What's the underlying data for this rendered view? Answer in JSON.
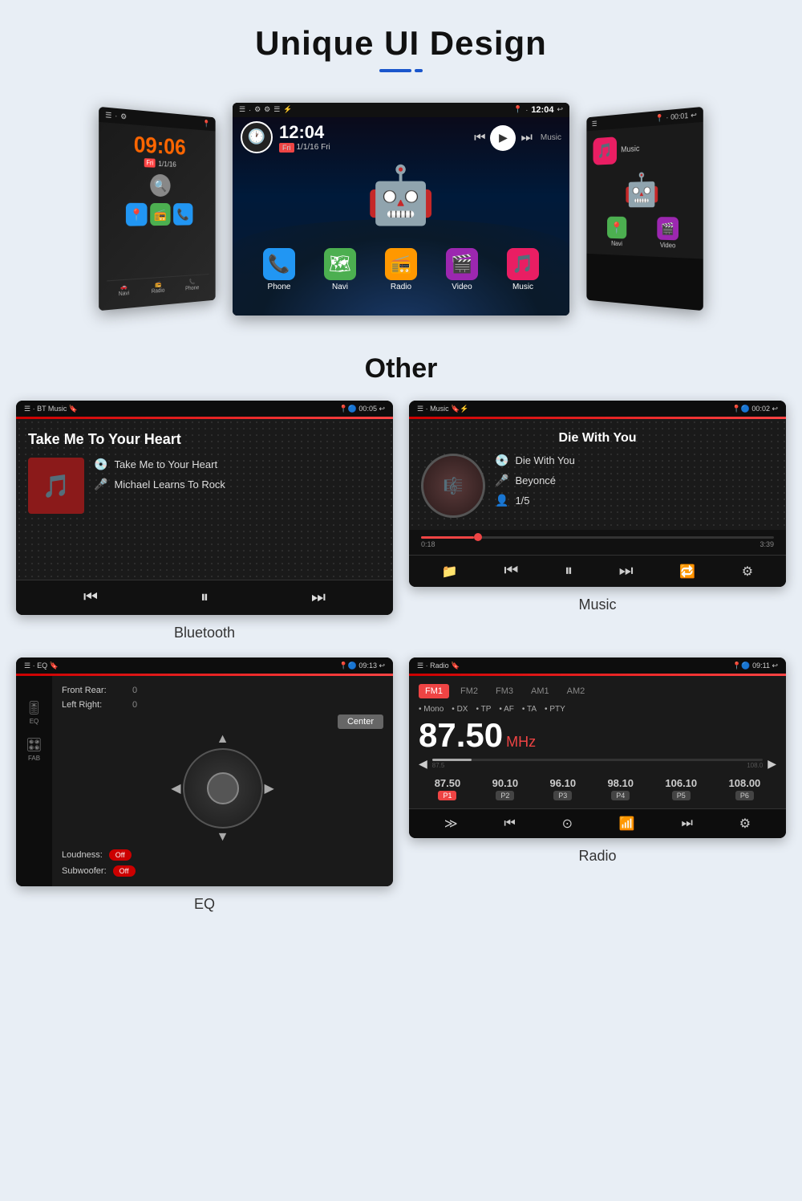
{
  "header": {
    "title": "Unique UI Design",
    "underline_long": "—",
    "underline_short": "·"
  },
  "ui_design_section": {
    "left_screen": {
      "status": "☰ · ⚙",
      "time": "09:06",
      "day": "Fri",
      "date": "1/1/16",
      "apps": [
        "📍",
        "📻",
        "📞"
      ],
      "nav_items": [
        "Navi",
        "Radio",
        "Phone"
      ]
    },
    "center_screen": {
      "status_left": "☰ · ⚙ ⚙ ☰ ⚡",
      "status_right": "📍 ·  12:04 ↩",
      "time": "12:04",
      "date": "1/1/16 Fri",
      "apps": [
        {
          "label": "Phone",
          "icon": "📞"
        },
        {
          "label": "Navi",
          "icon": "🗺"
        },
        {
          "label": "Radio",
          "icon": "📻"
        },
        {
          "label": "Video",
          "icon": "🎬"
        },
        {
          "label": "Music",
          "icon": "🎵"
        }
      ]
    },
    "right_screen": {
      "status_right": "📍 · 00:01 ↩",
      "apps": [
        {
          "label": "Music",
          "icon": "🎵"
        },
        {
          "label": "Navi",
          "icon": "📍"
        },
        {
          "label": "Video",
          "icon": "🎬"
        }
      ]
    }
  },
  "other_section": {
    "title": "Other",
    "screens": [
      {
        "id": "bluetooth",
        "label": "Bluetooth",
        "status_left": "☰ · BT Music 🔖",
        "status_right": "📍🔵 00:05 ↩",
        "title": "Take Me To Your Heart",
        "song": "Take Me to Your Heart",
        "artist": "Michael Learns To Rock",
        "controls": [
          "⏮",
          "⏸",
          "⏭"
        ]
      },
      {
        "id": "music",
        "label": "Music",
        "status_left": "☰ · Music 🔖⚡",
        "status_right": "📍🔵 00:02 ↩",
        "song_title": "Die With You",
        "song": "Die With You",
        "artist": "Beyoncé",
        "track": "1/5",
        "time_current": "0:18",
        "time_total": "3:39",
        "controls": [
          "📁",
          "⏮",
          "⏸",
          "⏭",
          "🔁",
          "⚙"
        ]
      },
      {
        "id": "eq",
        "label": "EQ",
        "status_left": "☰ · EQ 🔖",
        "status_right": "📍🔵 09:13 ↩",
        "front_rear_label": "Front Rear:",
        "front_rear_value": "0",
        "left_right_label": "Left Right:",
        "left_right_value": "0",
        "center_btn": "Center",
        "loudness_label": "Loudness:",
        "loudness_value": "Off",
        "subwoofer_label": "Subwoofer:",
        "subwoofer_value": "Off",
        "sidebar_items": [
          "EQ",
          "FAB"
        ]
      },
      {
        "id": "radio",
        "label": "Radio",
        "status_left": "☰ · Radio 🔖",
        "status_right": "📍🔵 09:11 ↩",
        "bands": [
          "FM1",
          "FM2",
          "FM3",
          "AM1",
          "AM2"
        ],
        "active_band": "FM1",
        "options": [
          "Mono",
          "DX",
          "TP",
          "AF",
          "TA",
          "PTY"
        ],
        "frequency": "87.50",
        "unit": "MHz",
        "presets": [
          {
            "freq": "87.50",
            "badge": "P1",
            "active": true
          },
          {
            "freq": "90.10",
            "badge": "P2",
            "active": false
          },
          {
            "freq": "96.10",
            "badge": "P3",
            "active": false
          },
          {
            "freq": "98.10",
            "badge": "P4",
            "active": false
          },
          {
            "freq": "106.10",
            "badge": "P5",
            "active": false
          },
          {
            "freq": "108.00",
            "badge": "P6",
            "active": false
          }
        ]
      }
    ]
  }
}
